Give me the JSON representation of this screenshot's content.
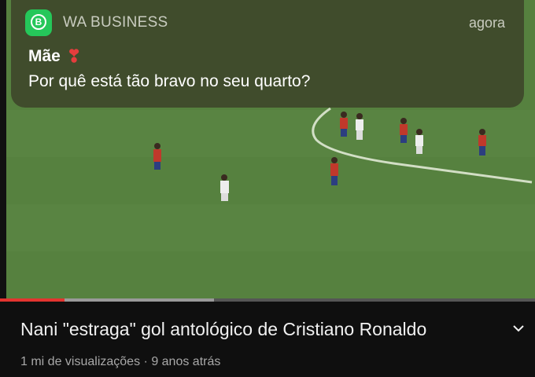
{
  "notification": {
    "app_name": "WA BUSINESS",
    "app_icon": "whatsapp-business-icon",
    "app_icon_letter": "B",
    "time": "agora",
    "sender": "Mãe",
    "sender_emoji": "❣",
    "message": "Por quê está tão bravo no seu quarto?"
  },
  "video": {
    "title": "Nani \"estraga\" gol antológico de Cristiano Ronaldo",
    "views": "1 mi de visualizações",
    "separator": "·",
    "age": "9 anos atrás",
    "expand_icon": "chevron-down-icon"
  },
  "player": {
    "played_fraction": 0.12,
    "buffered_fraction": 0.4
  },
  "colors": {
    "progress_played": "#e3342f",
    "app_icon_bg": "#25c75a",
    "pitch": "#55803f"
  }
}
